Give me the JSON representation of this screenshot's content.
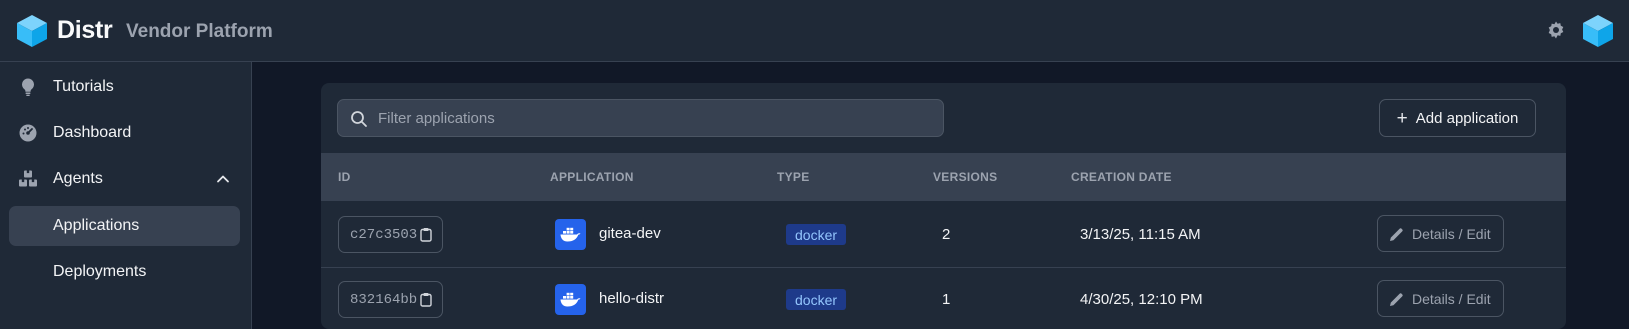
{
  "header": {
    "brand": "Distr",
    "subtitle": "Vendor Platform"
  },
  "sidebar": {
    "items": [
      {
        "label": "Tutorials",
        "icon": "lightbulb-icon"
      },
      {
        "label": "Dashboard",
        "icon": "gauge-icon"
      },
      {
        "label": "Agents",
        "icon": "boxes-icon",
        "expanded": true
      },
      {
        "label": "Applications",
        "active": true
      },
      {
        "label": "Deployments"
      }
    ]
  },
  "toolbar": {
    "search_placeholder": "Filter applications",
    "add_label": "Add application"
  },
  "table": {
    "columns": [
      "ID",
      "APPLICATION",
      "TYPE",
      "VERSIONS",
      "CREATION DATE"
    ],
    "rows": [
      {
        "id": "c27c3503",
        "name": "gitea-dev",
        "type": "docker",
        "versions": "2",
        "created": "3/13/25, 11:15 AM",
        "action": "Details / Edit"
      },
      {
        "id": "832164bb",
        "name": "hello-distr",
        "type": "docker",
        "versions": "1",
        "created": "4/30/25, 12:10 PM",
        "action": "Details / Edit"
      }
    ]
  },
  "colors": {
    "background": "#111827",
    "panel": "#1f2937",
    "accent": "#2563eb",
    "badge": "#1e3a8a"
  }
}
